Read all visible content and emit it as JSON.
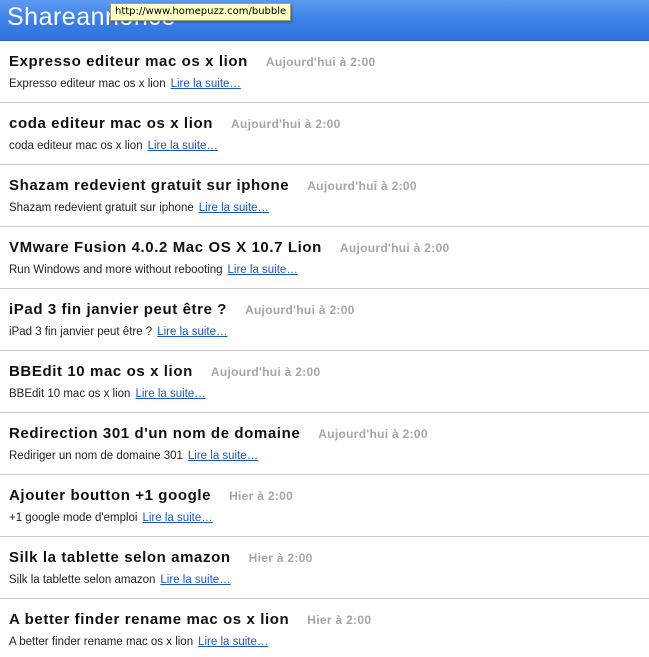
{
  "header": {
    "title": "Shareannonce",
    "tooltip": "http://www.homepuzz.com/bubble"
  },
  "articles": [
    {
      "title": "Expresso editeur mac os x lion",
      "date": "Aujourd'hui à  2:00",
      "summary": "Expresso editeur mac os x lion",
      "link_label": "Lire la suite…"
    },
    {
      "title": "coda editeur mac os x lion",
      "date": "Aujourd'hui à  2:00",
      "summary": "coda editeur mac os x lion",
      "link_label": "Lire la suite…"
    },
    {
      "title": "Shazam redevient gratuit sur iphone",
      "date": "Aujourd'hui à  2:00",
      "summary": "Shazam redevient gratuit sur iphone",
      "link_label": "Lire la suite…"
    },
    {
      "title": "VMware Fusion 4.0.2 Mac OS X 10.7 Lion",
      "date": "Aujourd'hui à  2:00",
      "summary": "Run Windows and more without rebooting",
      "link_label": "Lire la suite…"
    },
    {
      "title": "iPad 3 fin janvier peut être ?",
      "date": "Aujourd'hui à  2:00",
      "summary": "iPad 3 fin janvier peut être ?",
      "link_label": "Lire la suite…"
    },
    {
      "title": "BBEdit 10 mac os x lion",
      "date": "Aujourd'hui à  2:00",
      "summary": "BBEdit 10 mac os x lion",
      "link_label": "Lire la suite…"
    },
    {
      "title": "Redirection 301 d'un nom de domaine",
      "date": "Aujourd'hui à  2:00",
      "summary": "Rediriger un nom de domaine 301",
      "link_label": "Lire la suite…"
    },
    {
      "title": "Ajouter boutton +1 google",
      "date": "Hier à  2:00",
      "summary": "+1 google mode d'emploi",
      "link_label": "Lire la suite…"
    },
    {
      "title": "Silk la tablette selon amazon",
      "date": "Hier à  2:00",
      "summary": "Silk la tablette selon amazon",
      "link_label": "Lire la suite…"
    },
    {
      "title": "A better finder rename mac os x lion",
      "date": "Hier à  2:00",
      "summary": "A better finder rename mac os x lion",
      "link_label": "Lire la suite…"
    }
  ]
}
